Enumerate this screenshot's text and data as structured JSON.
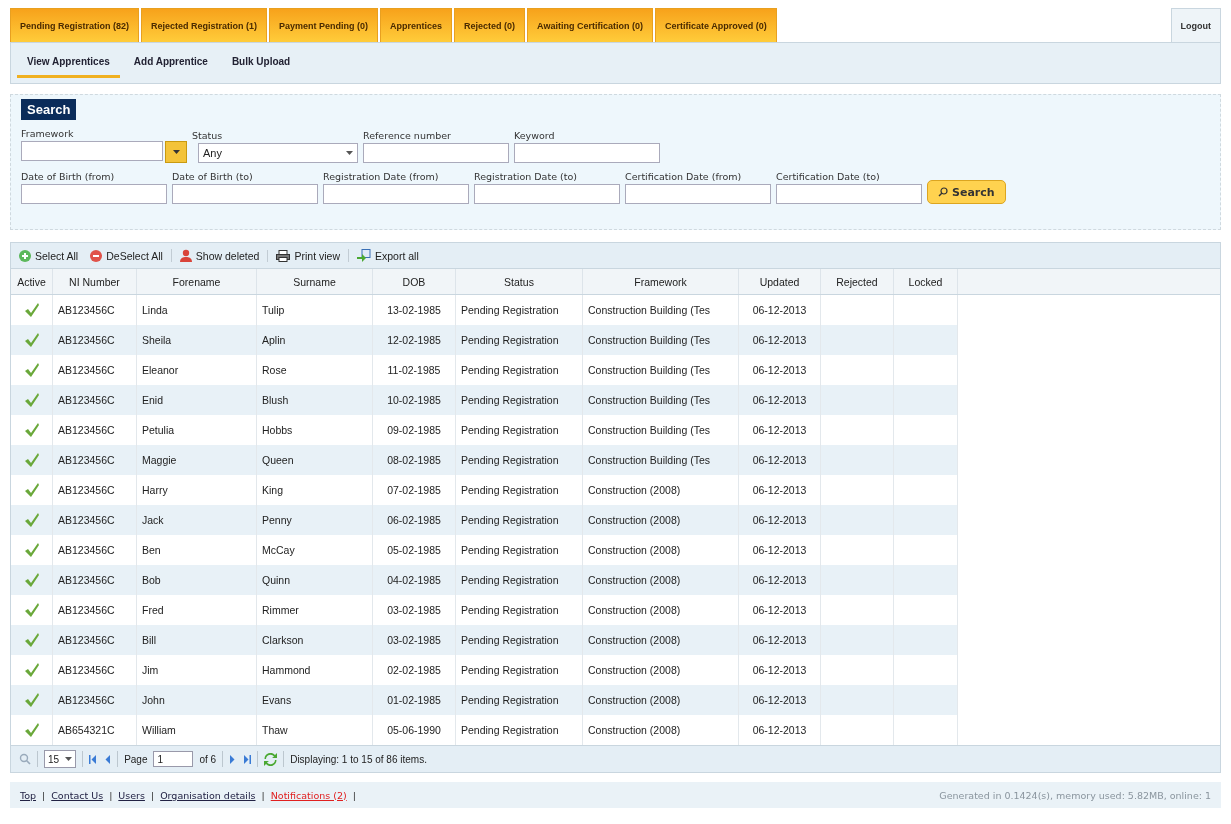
{
  "top_tabs": [
    {
      "label": "Pending Registration (82)"
    },
    {
      "label": "Rejected Registration (1)"
    },
    {
      "label": "Payment Pending (0)"
    },
    {
      "label": "Apprentices"
    },
    {
      "label": "Rejected (0)"
    },
    {
      "label": "Awaiting Certification (0)"
    },
    {
      "label": "Certificate Approved (0)"
    }
  ],
  "logout": "Logout",
  "sub_tabs": [
    {
      "label": "View Apprentices",
      "selected": true
    },
    {
      "label": "Add Apprentice",
      "selected": false
    },
    {
      "label": "Bulk Upload",
      "selected": false
    }
  ],
  "search": {
    "title": "Search",
    "fields": [
      {
        "label": "Framework",
        "kind": "combo"
      },
      {
        "label": "Status",
        "kind": "select",
        "value": "Any"
      },
      {
        "label": "Reference number",
        "kind": "text"
      },
      {
        "label": "Keyword",
        "kind": "text"
      }
    ],
    "date_fields": [
      {
        "label": "Date of Birth (from)"
      },
      {
        "label": "Date of Birth (to)"
      },
      {
        "label": "Registration Date (from)"
      },
      {
        "label": "Registration Date (to)"
      },
      {
        "label": "Certification Date (from)"
      },
      {
        "label": "Certification Date (to)"
      }
    ],
    "button": "Search"
  },
  "toolbar": [
    {
      "label": "Select All",
      "kind": "select-all"
    },
    {
      "label": "DeSelect All",
      "kind": "deselect-all"
    },
    {
      "label": "Show deleted",
      "kind": "person"
    },
    {
      "label": "Print view",
      "kind": "print"
    },
    {
      "label": "Export all",
      "kind": "export"
    }
  ],
  "table": {
    "columns": [
      "Active",
      "NI Number",
      "Forename",
      "Surname",
      "DOB",
      "Status",
      "Framework",
      "Updated",
      "Rejected",
      "Locked"
    ],
    "rows": [
      {
        "active": true,
        "ni": "AB123456C",
        "forename": "Linda",
        "surname": "Tulip",
        "dob": "13-02-1985",
        "status": "Pending Registration",
        "framework": "Construction Building (Tes",
        "updated": "06-12-2013"
      },
      {
        "active": true,
        "ni": "AB123456C",
        "forename": "Sheila",
        "surname": "Aplin",
        "dob": "12-02-1985",
        "status": "Pending Registration",
        "framework": "Construction Building (Tes",
        "updated": "06-12-2013"
      },
      {
        "active": true,
        "ni": "AB123456C",
        "forename": "Eleanor",
        "surname": "Rose",
        "dob": "11-02-1985",
        "status": "Pending Registration",
        "framework": "Construction Building (Tes",
        "updated": "06-12-2013"
      },
      {
        "active": true,
        "ni": "AB123456C",
        "forename": "Enid",
        "surname": "Blush",
        "dob": "10-02-1985",
        "status": "Pending Registration",
        "framework": "Construction Building (Tes",
        "updated": "06-12-2013"
      },
      {
        "active": true,
        "ni": "AB123456C",
        "forename": "Petulia",
        "surname": "Hobbs",
        "dob": "09-02-1985",
        "status": "Pending Registration",
        "framework": "Construction Building (Tes",
        "updated": "06-12-2013"
      },
      {
        "active": true,
        "ni": "AB123456C",
        "forename": "Maggie",
        "surname": "Queen",
        "dob": "08-02-1985",
        "status": "Pending Registration",
        "framework": "Construction Building (Tes",
        "updated": "06-12-2013"
      },
      {
        "active": true,
        "ni": "AB123456C",
        "forename": "Harry",
        "surname": "King",
        "dob": "07-02-1985",
        "status": "Pending Registration",
        "framework": "Construction (2008)",
        "updated": "06-12-2013"
      },
      {
        "active": true,
        "ni": "AB123456C",
        "forename": "Jack",
        "surname": "Penny",
        "dob": "06-02-1985",
        "status": "Pending Registration",
        "framework": "Construction (2008)",
        "updated": "06-12-2013"
      },
      {
        "active": true,
        "ni": "AB123456C",
        "forename": "Ben",
        "surname": "McCay",
        "dob": "05-02-1985",
        "status": "Pending Registration",
        "framework": "Construction (2008)",
        "updated": "06-12-2013"
      },
      {
        "active": true,
        "ni": "AB123456C",
        "forename": "Bob",
        "surname": "Quinn",
        "dob": "04-02-1985",
        "status": "Pending Registration",
        "framework": "Construction (2008)",
        "updated": "06-12-2013"
      },
      {
        "active": true,
        "ni": "AB123456C",
        "forename": "Fred",
        "surname": "Rimmer",
        "dob": "03-02-1985",
        "status": "Pending Registration",
        "framework": "Construction (2008)",
        "updated": "06-12-2013"
      },
      {
        "active": true,
        "ni": "AB123456C",
        "forename": "Bill",
        "surname": "Clarkson",
        "dob": "03-02-1985",
        "status": "Pending Registration",
        "framework": "Construction (2008)",
        "updated": "06-12-2013"
      },
      {
        "active": true,
        "ni": "AB123456C",
        "forename": "Jim",
        "surname": "Hammond",
        "dob": "02-02-1985",
        "status": "Pending Registration",
        "framework": "Construction (2008)",
        "updated": "06-12-2013"
      },
      {
        "active": true,
        "ni": "AB123456C",
        "forename": "John",
        "surname": "Evans",
        "dob": "01-02-1985",
        "status": "Pending Registration",
        "framework": "Construction (2008)",
        "updated": "06-12-2013"
      },
      {
        "active": true,
        "ni": "AB654321C",
        "forename": "William",
        "surname": "Thaw",
        "dob": "05-06-1990",
        "status": "Pending Registration",
        "framework": "Construction (2008)",
        "updated": "06-12-2013"
      }
    ]
  },
  "pager": {
    "page_size": "15",
    "page_label": "Page",
    "page": "1",
    "of": "of 6",
    "display": "Displaying: 1 to 15 of 86 items."
  },
  "footer": {
    "links": [
      {
        "label": "Top",
        "alert": false
      },
      {
        "label": "Contact Us",
        "alert": false
      },
      {
        "label": "Users",
        "alert": false
      },
      {
        "label": "Organisation details",
        "alert": false
      },
      {
        "label": "Notifications (2)",
        "alert": true
      }
    ],
    "separator": "|",
    "info": "Generated in 0.1424(s), memory used: 5.82MB, online: 1"
  }
}
